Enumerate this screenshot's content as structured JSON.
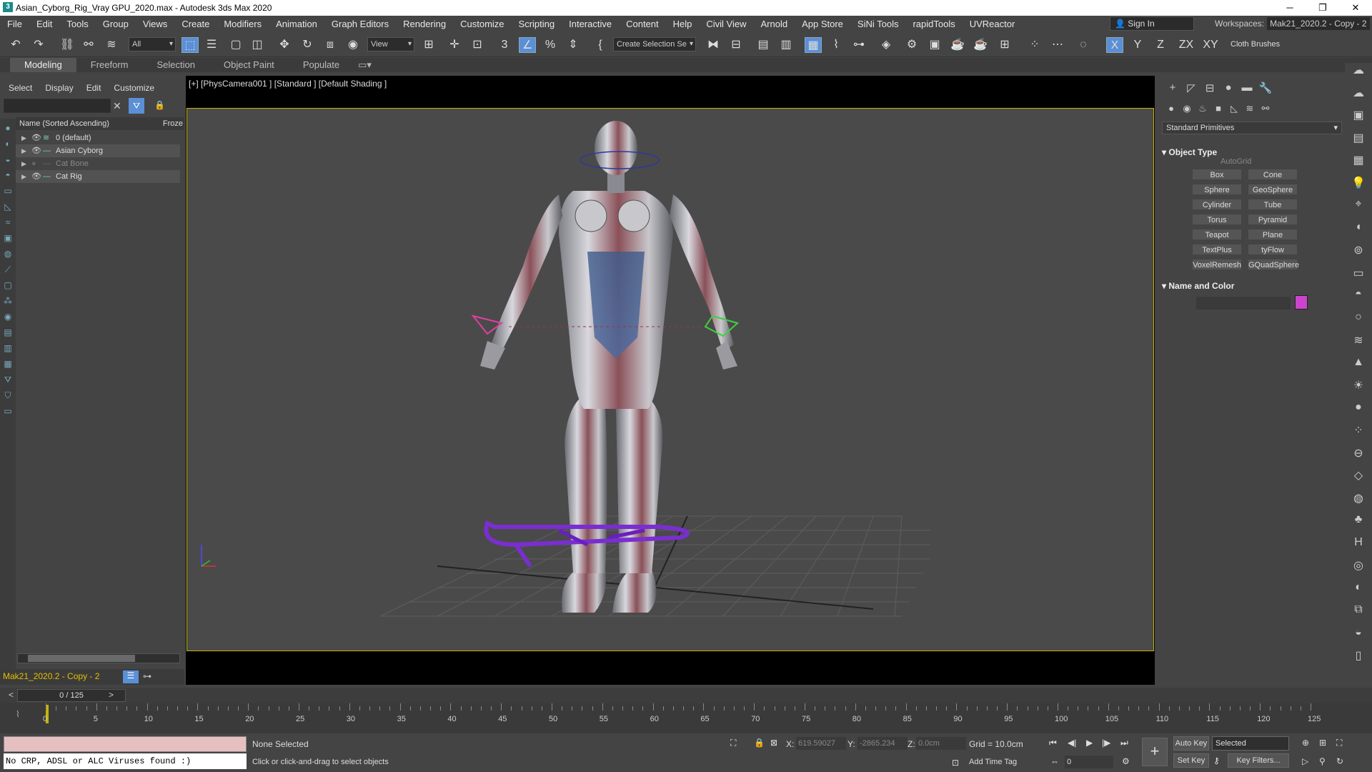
{
  "window": {
    "title": "Asian_Cyborg_Rig_Vray GPU_2020.max - Autodesk 3ds Max 2020",
    "minimize": "─",
    "maximize": "❐",
    "close": "✕"
  },
  "menu": [
    "File",
    "Edit",
    "Tools",
    "Group",
    "Views",
    "Create",
    "Modifiers",
    "Animation",
    "Graph Editors",
    "Rendering",
    "Customize",
    "Scripting",
    "Interactive",
    "Content",
    "Help",
    "Civil View",
    "Arnold",
    "App Store",
    "SiNi Tools",
    "rapidTools",
    "UVReactor"
  ],
  "signin": "Sign In",
  "workspace": {
    "label": "Workspaces:",
    "value": "Mak21_2020.2 - Copy - 2"
  },
  "toolbar": {
    "filter": "All",
    "refcoord": "View",
    "selset": "Create Selection Se",
    "cloth": "Cloth Brushes",
    "axes": [
      "X",
      "Y",
      "Z",
      "ZX",
      "XY"
    ]
  },
  "ribbon": [
    "Modeling",
    "Freeform",
    "Selection",
    "Object Paint",
    "Populate"
  ],
  "scene": {
    "menu": [
      "Select",
      "Display",
      "Edit",
      "Customize"
    ],
    "header": "Name (Sorted Ascending)",
    "froze": "Froze",
    "rows": [
      {
        "name": "0 (default)"
      },
      {
        "name": "Asian Cyborg"
      },
      {
        "name": "Cat Bone"
      },
      {
        "name": "Cat Rig"
      }
    ],
    "layer": "Mak21_2020.2 - Copy - 2"
  },
  "viewport": {
    "label": "[+] [PhysCamera001 ] [Standard ] [Default Shading ]"
  },
  "command": {
    "category": "Standard Primitives",
    "object_type": "Object Type",
    "autogrid": "AutoGrid",
    "buttons": [
      "Box",
      "Cone",
      "Sphere",
      "GeoSphere",
      "Cylinder",
      "Tube",
      "Torus",
      "Pyramid",
      "Teapot",
      "Plane",
      "TextPlus",
      "tyFlow",
      "VoxelRemesh",
      "GQuadSphere"
    ],
    "name_color": "Name and Color",
    "swatch_color": "#cc44cc"
  },
  "timeline": {
    "frame": "0 / 125",
    "ticks": [
      "0",
      "5",
      "10",
      "15",
      "20",
      "25",
      "30",
      "35",
      "40",
      "45",
      "50",
      "55",
      "60",
      "65",
      "70",
      "75",
      "80",
      "85",
      "90",
      "95",
      "100",
      "105",
      "110",
      "115",
      "120",
      "125"
    ]
  },
  "status": {
    "maxscript": "No CRP, ADSL or ALC Viruses found :)",
    "selection": "None Selected",
    "prompt": "Click or click-and-drag to select objects",
    "x_label": "X:",
    "x": "619.59027",
    "y_label": "Y:",
    "y": "-2865.234",
    "z_label": "Z:",
    "z": "0.0cm",
    "grid": "Grid = 10.0cm",
    "add_time_tag": "Add Time Tag",
    "auto_key": "Auto Key",
    "selected": "Selected",
    "set_key": "Set Key",
    "key_filters": "Key Filters...",
    "current_frame": "0"
  }
}
